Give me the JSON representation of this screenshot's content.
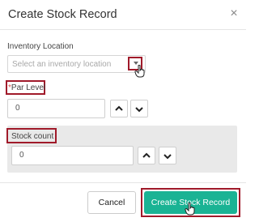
{
  "dialog": {
    "title": "Create Stock Record",
    "close_glyph": "×"
  },
  "inventory_location": {
    "label": "Inventory Location",
    "placeholder": "Select an inventory location"
  },
  "par_level": {
    "required_mark": "*",
    "label": "Par Level",
    "value": "0"
  },
  "stock_count": {
    "label": "Stock count",
    "value": "0"
  },
  "footer": {
    "cancel_label": "Cancel",
    "create_label": "Create Stock Record"
  },
  "colors": {
    "accent": "#1ab394",
    "highlight": "#a01a2a"
  },
  "icons": [
    "close-icon",
    "chevron-down-icon",
    "chevron-up-icon",
    "pointer-cursor-icon"
  ]
}
